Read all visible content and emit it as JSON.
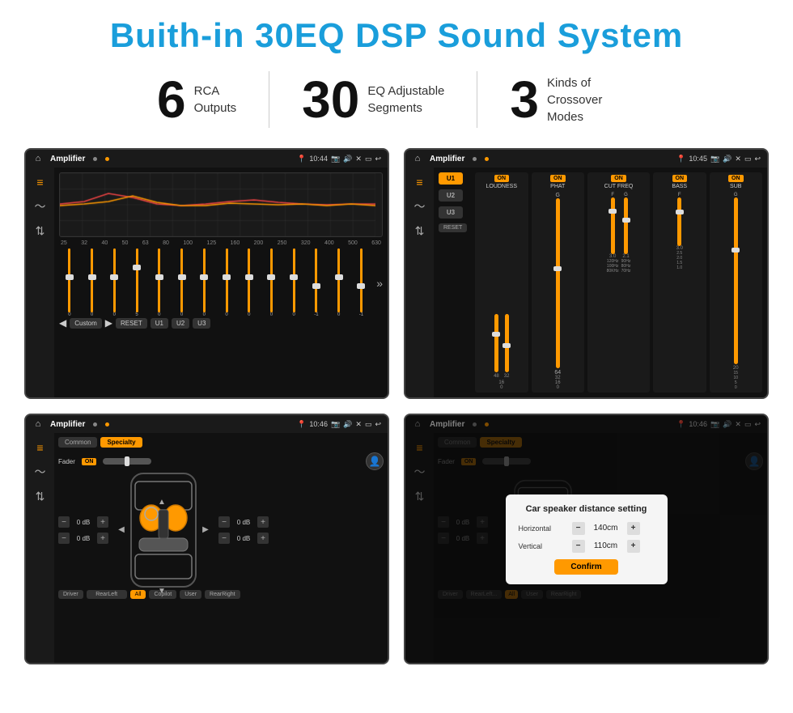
{
  "title": "Buith-in 30EQ DSP Sound System",
  "stats": [
    {
      "number": "6",
      "text": "RCA\nOutputs"
    },
    {
      "number": "30",
      "text": "EQ Adjustable\nSegments"
    },
    {
      "number": "3",
      "text": "Kinds of\nCrossover Modes"
    }
  ],
  "screens": {
    "eq": {
      "topbar": {
        "title": "Amplifier",
        "time": "10:44"
      },
      "freqs": [
        "25",
        "32",
        "40",
        "50",
        "63",
        "80",
        "100",
        "125",
        "160",
        "200",
        "250",
        "320",
        "400",
        "500",
        "630"
      ],
      "values": [
        "0",
        "0",
        "0",
        "5",
        "0",
        "0",
        "0",
        "0",
        "0",
        "0",
        "0",
        "-1",
        "0",
        "-1"
      ],
      "buttons": [
        "Custom",
        "RESET",
        "U1",
        "U2",
        "U3"
      ]
    },
    "crossover": {
      "topbar": {
        "title": "Amplifier",
        "time": "10:45"
      },
      "u_buttons": [
        "U1",
        "U2",
        "U3"
      ],
      "cols": [
        "LOUDNESS",
        "PHAT",
        "CUT FREQ",
        "BASS",
        "SUB"
      ],
      "reset_label": "RESET"
    },
    "fader": {
      "topbar": {
        "title": "Amplifier",
        "time": "10:46"
      },
      "tabs": [
        "Common",
        "Specialty"
      ],
      "fader_label": "Fader",
      "on_label": "ON",
      "vol_left_top": "0 dB",
      "vol_left_bottom": "0 dB",
      "vol_right_top": "0 dB",
      "vol_right_bottom": "0 dB",
      "bottom_btns": [
        "Driver",
        "RearLeft",
        "All",
        "Copilot",
        "User",
        "RearRight"
      ]
    },
    "dialog": {
      "topbar": {
        "title": "Amplifier",
        "time": "10:46"
      },
      "tabs": [
        "Common",
        "Specialty"
      ],
      "fader_label": "Fader",
      "on_label": "ON",
      "dialog_title": "Car speaker distance setting",
      "horizontal_label": "Horizontal",
      "horizontal_value": "140cm",
      "vertical_label": "Vertical",
      "vertical_value": "110cm",
      "vol_right_top": "0 dB",
      "vol_right_bottom": "0 dB",
      "confirm_label": "Confirm",
      "bottom_btns": [
        "Driver",
        "RearLeft",
        "All",
        "Copilot",
        "User",
        "RearRight"
      ]
    }
  }
}
